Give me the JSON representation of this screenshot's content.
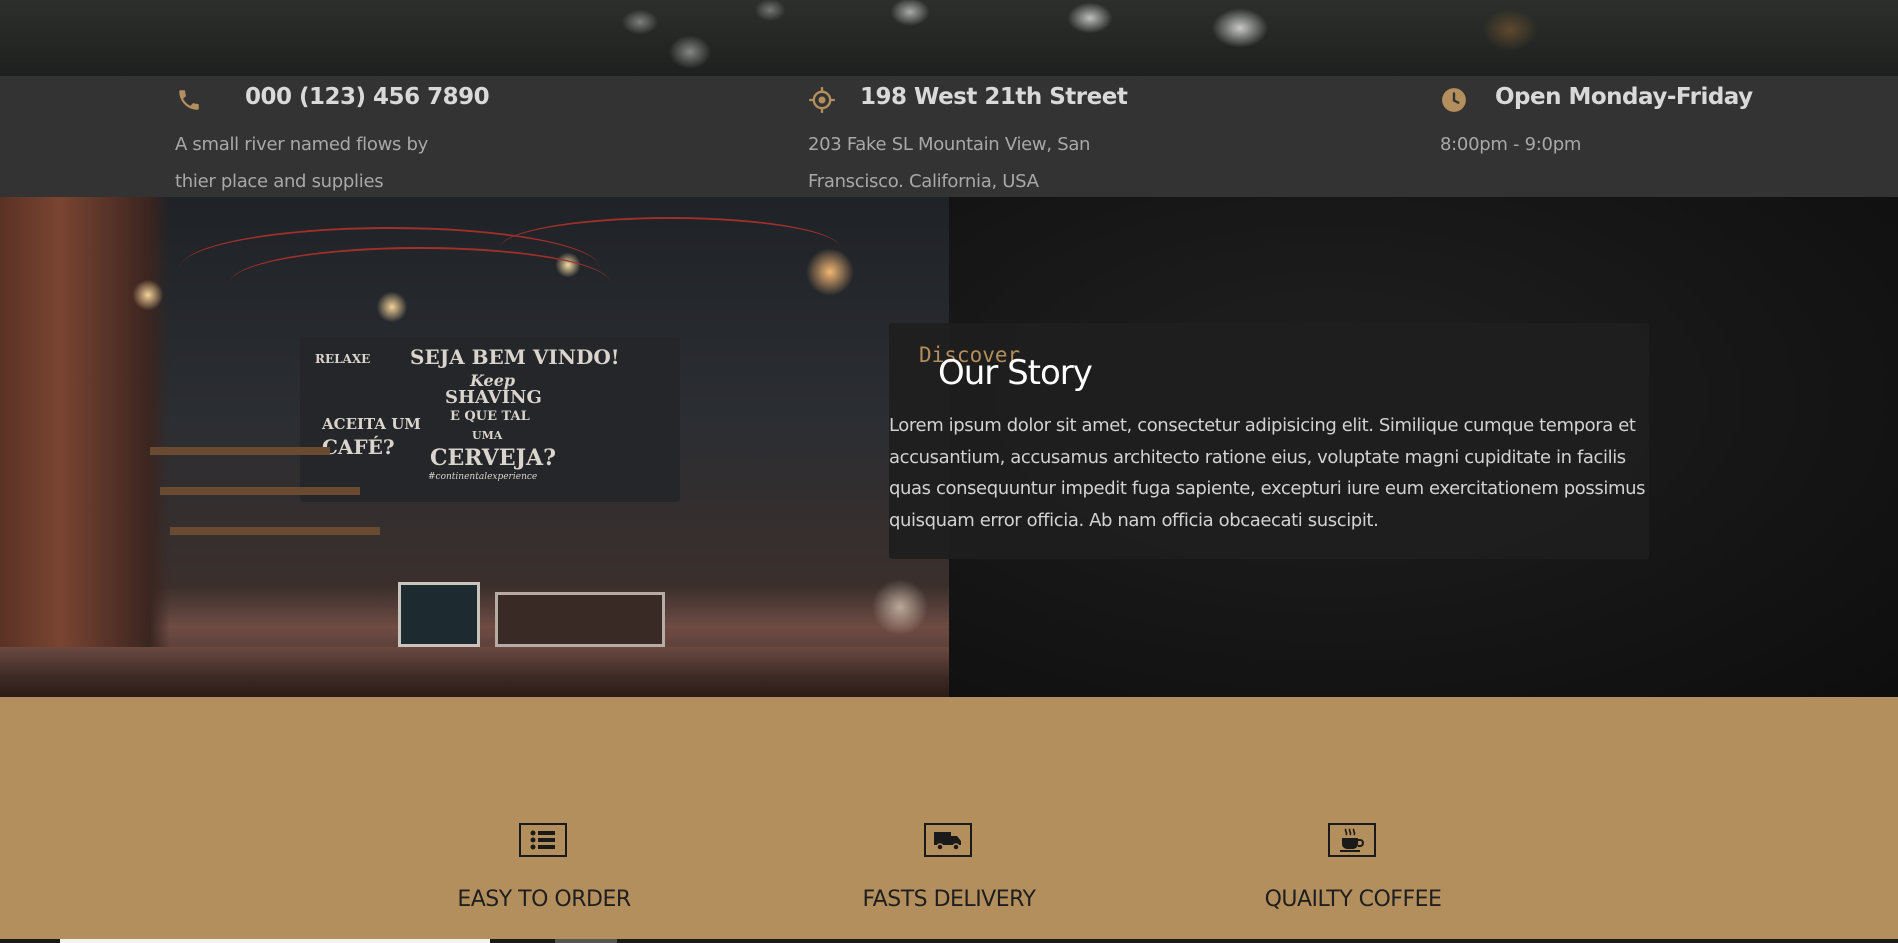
{
  "contact_bar": {
    "phone": {
      "icon": "phone-icon",
      "title": "000 (123) 456 7890",
      "lines": [
        "A small river named flows by",
        "thier place and supplies"
      ]
    },
    "address": {
      "icon": "location-icon",
      "title": "198 West 21th Street",
      "lines": [
        "203 Fake SL Mountain View, San",
        "Franscisco. California, USA"
      ]
    },
    "hours": {
      "icon": "clock-icon",
      "title": "Open Monday-Friday",
      "lines": [
        "8:00pm - 9:0pm"
      ]
    }
  },
  "story": {
    "eyebrow": "Discover",
    "title": "Our Story",
    "text": "Lorem ipsum dolor sit amet, consectetur adipisicing elit. Similique cumque tempora et accusantium, accusamus architecto ratione eius, voluptate magni cupiditate in facilis quas consequuntur impedit fuga sapiente, excepturi iure eum exercitationem possimus quisquam error officia. Ab nam officia obcaecati suscipit."
  },
  "photo_sign": {
    "line1": "SEJA BEM VINDO!",
    "line2": "Keep",
    "line3": "SHAVING",
    "line4": "E QUE TAL",
    "line5": "UMA",
    "left1": "RELAXE",
    "left2": "ACEITA UM",
    "left3": "CAFÉ?",
    "right": "CERVEJA?",
    "hashtag": "#continentalexperience"
  },
  "features": [
    {
      "icon": "list-icon",
      "label": "EASY TO ORDER"
    },
    {
      "icon": "truck-icon",
      "label": "FASTS DELIVERY"
    },
    {
      "icon": "coffee-cup-icon",
      "label": "QUAILTY COFFEE"
    }
  ],
  "colors": {
    "accent": "#b38f5e",
    "info_bar": "#333333",
    "discover_text": "#b38d5a"
  }
}
